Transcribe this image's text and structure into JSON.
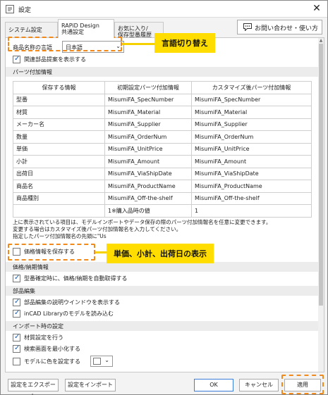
{
  "window": {
    "title": "設定"
  },
  "tabs": [
    {
      "label": "システム設定"
    },
    {
      "label": "RAPiD Design\n共通設定"
    },
    {
      "label": "お気に入り/\n保存型番履歴"
    }
  ],
  "support_button": {
    "label": "お問い合わせ・使い方",
    "icon": "chat-icon"
  },
  "language": {
    "label": "商品名称の言語",
    "value": "日本語"
  },
  "show_related": {
    "label": "関連部品提案を表示する",
    "checked": true
  },
  "parts_section": {
    "title": "パーツ付加情報"
  },
  "attr_table": {
    "headers": [
      "保存する情報",
      "初期設定パーツ付加情報",
      "カスタマイズ後パーツ付加情報"
    ],
    "rows": [
      [
        "型番",
        "MisumiFA_SpecNumber",
        "MisumiFA_SpecNumber"
      ],
      [
        "材質",
        "MisumiFA_Material",
        "MisumiFA_Material"
      ],
      [
        "メーカー名",
        "MisumiFA_Supplier",
        "MisumiFA_Supplier"
      ],
      [
        "数量",
        "MisumiFA_OrderNum",
        "MisumiFA_OrderNum"
      ],
      [
        "単価",
        "MisumiFA_UnitPrice",
        "MisumiFA_UnitPrice"
      ],
      [
        "小計",
        "MisumiFA_Amount",
        "MisumiFA_Amount"
      ],
      [
        "出荷日",
        "MisumiFA_ViaShipDate",
        "MisumiFA_ViaShipDate"
      ],
      [
        "商品名",
        "MisumiFA_ProductName",
        "MisumiFA_ProductName"
      ],
      [
        "商品種別",
        "MisumiFA_Off-the-shelf",
        "MisumiFA_Off-the-shelf"
      ],
      [
        "",
        "1※購入品時の値",
        "1"
      ]
    ]
  },
  "notes": [
    "上に表示されている項目は、モデルインポートやデータ保存の際のパーツ付加情報名を任意に変更できます。",
    "変更する場合はカスタマイズ後パーツ付加情報名を入力してください。",
    "指定したパーツ付加情報名の先頭に\"Us"
  ],
  "save_price": {
    "label": "価格情報を保存する",
    "checked": false
  },
  "price_section": {
    "title": "価格/納期情報"
  },
  "auto_fetch": {
    "label": "型番確定時に、価格/納期を自動取得する",
    "checked": true
  },
  "edit_section": {
    "title": "部品編集"
  },
  "show_help": {
    "label": "部品編集の説明ウインドウを表示する",
    "checked": true
  },
  "load_incad": {
    "label": "inCAD Libraryのモデルを読み込む",
    "checked": true
  },
  "import_section": {
    "title": "インポート時の設定"
  },
  "material_setting": {
    "label": "材質設定を行う",
    "checked": true
  },
  "minimize_search": {
    "label": "検索画面を最小化する",
    "checked": true
  },
  "model_color": {
    "label": "モデルに色を設定する",
    "checked": false
  },
  "callouts": {
    "language": "言語切り替え",
    "price": "単価、小計、出荷日の表示"
  },
  "footer": {
    "export": "設定をエクスポート",
    "import": "設定をインポート",
    "ok": "OK",
    "cancel": "キャンセル",
    "apply": "適用"
  },
  "colors": {
    "callout": "#ffdd00",
    "highlight_dash": "#f08a1c"
  }
}
